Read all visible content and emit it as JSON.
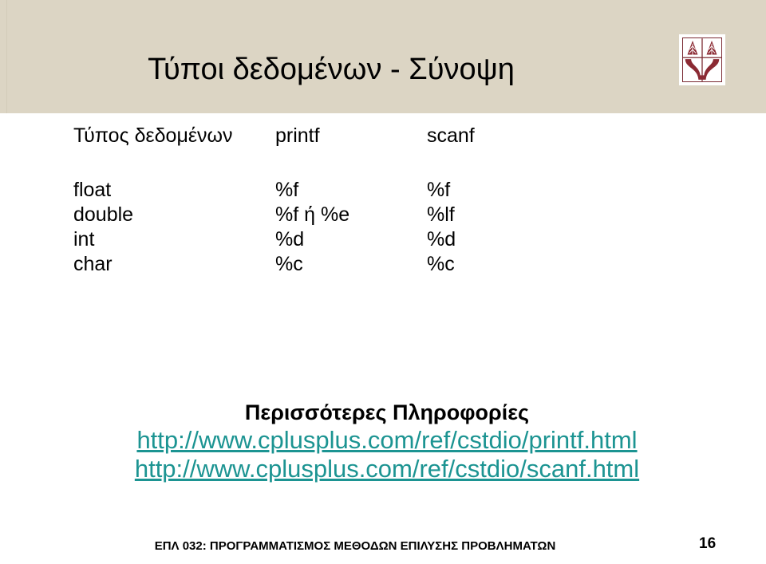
{
  "slide": {
    "title": "Τύποι δεδομένων - Σύνοψη",
    "page_number": "16",
    "footer": "ΕΠΛ 032: ΠΡΟΓΡΑΜΜΑΤΙΣΜΟΣ ΜΕΘΟΔΩΝ ΕΠΙΛΥΣΗΣ ΠΡΟΒΛΗΜΑΤΩΝ",
    "banner_color": "#dcd5c4",
    "link_color": "#1c9492",
    "logo_color": "#7b2b33",
    "logo_name": "university-of-cyprus-emblem"
  },
  "table": {
    "headers": {
      "type": "Τύπος δεδομένων",
      "printf": "printf",
      "scanf": "scanf"
    },
    "rows": [
      {
        "type": "float",
        "printf": "%f",
        "scanf": "%f"
      },
      {
        "type": "double",
        "printf": "%f ή %e",
        "scanf": "%lf"
      },
      {
        "type": "int",
        "printf": "%d",
        "scanf": "%d"
      },
      {
        "type": "char",
        "printf": "%c",
        "scanf": "%c"
      }
    ]
  },
  "more_info": {
    "heading": "Περισσότερες Πληροφορίες",
    "links": [
      "http://www.cplusplus.com/ref/cstdio/printf.html",
      "http://www.cplusplus.com/ref/cstdio/scanf.html"
    ]
  }
}
